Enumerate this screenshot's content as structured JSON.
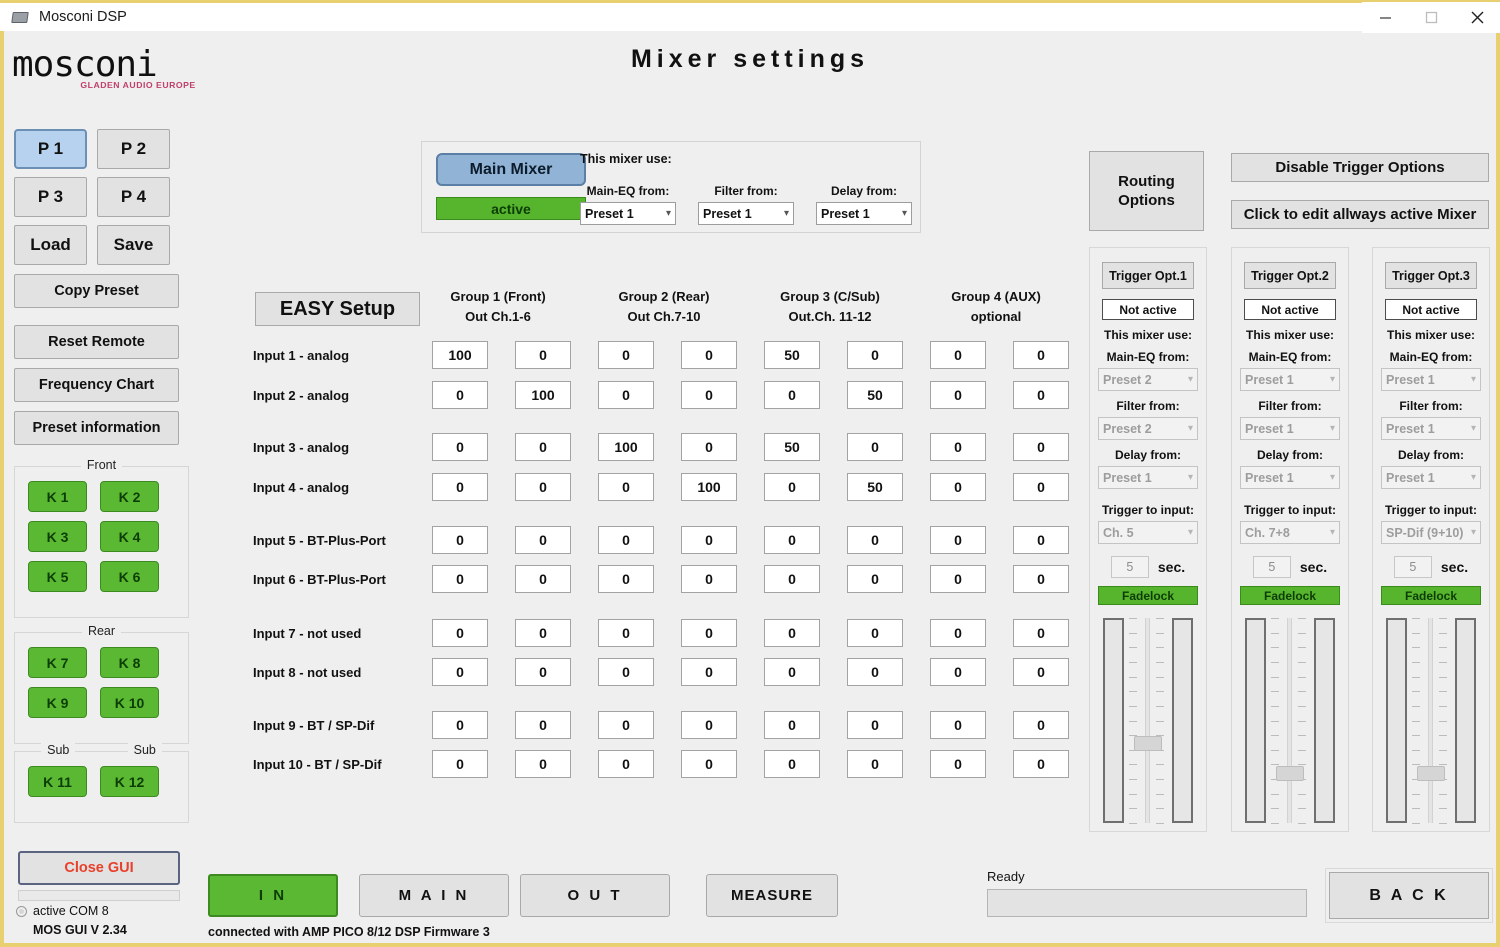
{
  "window": {
    "title": "Mosconi DSP",
    "icon": "app-window-icon",
    "minimize": "–",
    "maximize": "□",
    "close": "✕"
  },
  "brand": {
    "name": "mosconi",
    "tagline": "GLADEN AUDIO EUROPE",
    "tagline_color": "#c0406a"
  },
  "page_title": "Mixer   settings",
  "sidebar": {
    "presets": [
      "P 1",
      "P 2",
      "P 3",
      "P 4",
      "Load",
      "Save"
    ],
    "selected_preset": "P 1",
    "copy_preset": "Copy Preset",
    "reset_remote": "Reset Remote",
    "frequency_chart": "Frequency Chart",
    "preset_information": "Preset information",
    "channel_groups": [
      {
        "legend": "Front",
        "legends": [
          "Front"
        ],
        "buttons": [
          "K 1",
          "K 2",
          "K 3",
          "K 4",
          "K 5",
          "K 6"
        ]
      },
      {
        "legend": "Rear",
        "legends": [
          "Rear"
        ],
        "buttons": [
          "K 7",
          "K 8",
          "K 9",
          "K 10"
        ]
      },
      {
        "legend": "Sub",
        "legends": [
          "Sub",
          "Sub"
        ],
        "buttons": [
          "K 11",
          "K 12"
        ]
      }
    ],
    "close_gui": "Close GUI",
    "com_status": "active COM 8",
    "version": "MOS GUI V 2.34"
  },
  "main_mixer": {
    "title": "Main Mixer",
    "state": "active",
    "use_label": "This mixer use:",
    "selects": [
      {
        "label": "Main-EQ from:",
        "value": "Preset 1"
      },
      {
        "label": "Filter from:",
        "value": "Preset 1"
      },
      {
        "label": "Delay from:",
        "value": "Preset 1"
      }
    ]
  },
  "matrix": {
    "easy_setup": "EASY Setup",
    "groups": [
      {
        "title": "Group 1 (Front)",
        "sub": "Out Ch.1-6"
      },
      {
        "title": "Group 2 (Rear)",
        "sub": "Out Ch.7-10"
      },
      {
        "title": "Group 3 (C/Sub)",
        "sub": "Out.Ch. 11-12"
      },
      {
        "title": "Group 4 (AUX)",
        "sub": "optional"
      }
    ],
    "rows": [
      {
        "label": "Input 1 - analog",
        "values": [
          "100",
          "0",
          "0",
          "0",
          "50",
          "0",
          "0",
          "0"
        ]
      },
      {
        "label": "Input 2 - analog",
        "values": [
          "0",
          "100",
          "0",
          "0",
          "0",
          "50",
          "0",
          "0"
        ]
      },
      {
        "label": "Input 3 - analog",
        "values": [
          "0",
          "0",
          "100",
          "0",
          "50",
          "0",
          "0",
          "0"
        ]
      },
      {
        "label": "Input 4 - analog",
        "values": [
          "0",
          "0",
          "0",
          "100",
          "0",
          "50",
          "0",
          "0"
        ]
      },
      {
        "label": "Input 5 - BT-Plus-Port",
        "values": [
          "0",
          "0",
          "0",
          "0",
          "0",
          "0",
          "0",
          "0"
        ]
      },
      {
        "label": "Input 6 - BT-Plus-Port",
        "values": [
          "0",
          "0",
          "0",
          "0",
          "0",
          "0",
          "0",
          "0"
        ]
      },
      {
        "label": "Input 7 - not used",
        "values": [
          "0",
          "0",
          "0",
          "0",
          "0",
          "0",
          "0",
          "0"
        ]
      },
      {
        "label": "Input 8 - not used",
        "values": [
          "0",
          "0",
          "0",
          "0",
          "0",
          "0",
          "0",
          "0"
        ]
      },
      {
        "label": "Input 9 - BT / SP-Dif",
        "values": [
          "0",
          "0",
          "0",
          "0",
          "0",
          "0",
          "0",
          "0"
        ]
      },
      {
        "label": "Input 10 - BT / SP-Dif",
        "values": [
          "0",
          "0",
          "0",
          "0",
          "0",
          "0",
          "0",
          "0"
        ]
      }
    ]
  },
  "right": {
    "routing_options": "Routing\nOptions",
    "routing_options_l1": "Routing",
    "routing_options_l2": "Options",
    "disable_trigger": "Disable Trigger Options",
    "edit_always_mixer": "Click to edit allways active Mixer",
    "use_label": "This mixer use:",
    "trigger_input_label": "Trigger to input:",
    "sec_label": "sec.",
    "fadelock": "Fadelock",
    "triggers": [
      {
        "name": "Trigger Opt.1",
        "state": "Not active",
        "selects": [
          {
            "label": "Main-EQ from:",
            "value": "Preset 2"
          },
          {
            "label": "Filter from:",
            "value": "Preset 2"
          },
          {
            "label": "Delay from:",
            "value": "Preset 1"
          }
        ],
        "trigger_input": "Ch. 5",
        "seconds": "5",
        "slider_pct": 62
      },
      {
        "name": "Trigger Opt.2",
        "state": "Not active",
        "selects": [
          {
            "label": "Main-EQ from:",
            "value": "Preset 1"
          },
          {
            "label": "Filter from:",
            "value": "Preset 1"
          },
          {
            "label": "Delay from:",
            "value": "Preset 1"
          }
        ],
        "trigger_input": "Ch. 7+8",
        "seconds": "5",
        "slider_pct": 78
      },
      {
        "name": "Trigger Opt.3",
        "state": "Not active",
        "selects": [
          {
            "label": "Main-EQ from:",
            "value": "Preset 1"
          },
          {
            "label": "Filter from:",
            "value": "Preset 1"
          },
          {
            "label": "Delay from:",
            "value": "Preset 1"
          }
        ],
        "trigger_input": "SP-Dif (9+10)",
        "seconds": "5",
        "slider_pct": 78
      }
    ]
  },
  "bottom": {
    "nav": [
      "I N",
      "M A I N",
      "O U T"
    ],
    "active_nav": "I N",
    "measure": "MEASURE",
    "connection": "connected with AMP PICO 8/12 DSP Firmware 3",
    "ready": "Ready",
    "back": "B A C K"
  }
}
